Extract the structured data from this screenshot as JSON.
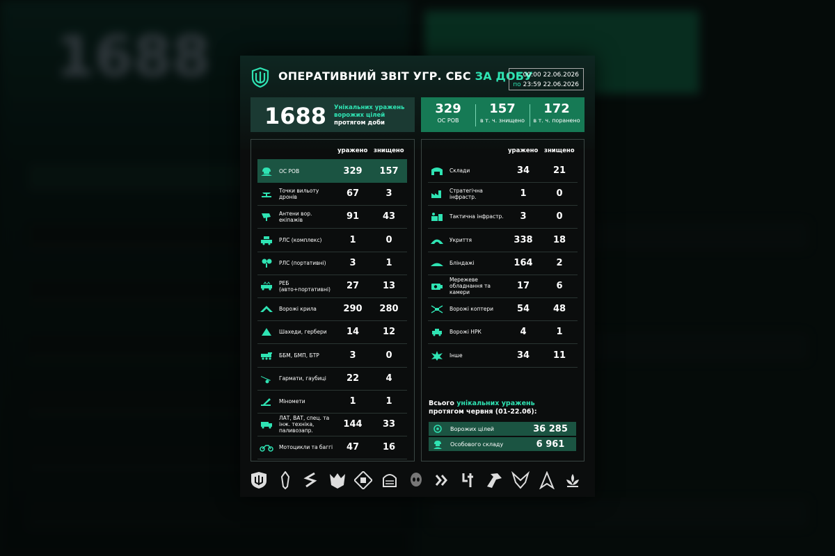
{
  "title": {
    "main": "ОПЕРАТИВНИЙ ЗВІТ УГР. СБС",
    "accent": "ЗА ДОБУ"
  },
  "period": {
    "from_prefix": "з",
    "from_time": "00:00",
    "from_date": "22.06.2026",
    "to_prefix": "по",
    "to_time": "23:59",
    "to_date": "22.06.2026"
  },
  "summary": {
    "unique_hits": "1688",
    "unique_hits_desc_1": "Унікальних уражень",
    "unique_hits_desc_2": "ворожих цілей",
    "unique_hits_desc_3": "протягом доби",
    "stats": [
      {
        "value": "329",
        "caption": "ОС РОВ"
      },
      {
        "value": "157",
        "caption": "в т. ч. знищено"
      },
      {
        "value": "172",
        "caption": "в т. ч. поранено"
      }
    ]
  },
  "table_headers": {
    "hit": "уражено",
    "destroyed": "знищено"
  },
  "left_rows": [
    {
      "icon": "soldier-icon",
      "label": "ОС РОВ",
      "hit": "329",
      "destroyed": "157",
      "highlight": true
    },
    {
      "icon": "drone-launch-icon",
      "label": "Точки вильоту дронів",
      "hit": "67",
      "destroyed": "3"
    },
    {
      "icon": "antenna-icon",
      "label": "Антени вор. екіпажів",
      "hit": "91",
      "destroyed": "43"
    },
    {
      "icon": "rls-complex-icon",
      "label": "РЛС (комплекс)",
      "hit": "1",
      "destroyed": "0"
    },
    {
      "icon": "rls-portable-icon",
      "label": "РЛС (портативні)",
      "hit": "3",
      "destroyed": "1"
    },
    {
      "icon": "ew-icon",
      "label": "РЕБ (авто+портативні)",
      "hit": "27",
      "destroyed": "13"
    },
    {
      "icon": "wing-icon",
      "label": "Ворожі крила",
      "hit": "290",
      "destroyed": "280"
    },
    {
      "icon": "shahed-icon",
      "label": "Шахеди, гербери",
      "hit": "14",
      "destroyed": "12"
    },
    {
      "icon": "ifv-icon",
      "label": "ББМ, БМП, БТР",
      "hit": "3",
      "destroyed": "0"
    },
    {
      "icon": "artillery-icon",
      "label": "Гармати, гаубиці",
      "hit": "22",
      "destroyed": "4"
    },
    {
      "icon": "mortar-icon",
      "label": "Міномети",
      "hit": "1",
      "destroyed": "1"
    },
    {
      "icon": "truck-icon",
      "label": "ЛАТ, ВАТ, спец. та інж. техніка, паливозапр.",
      "hit": "144",
      "destroyed": "33"
    },
    {
      "icon": "motorcycle-icon",
      "label": "Мотоцикли та баггі",
      "hit": "47",
      "destroyed": "16"
    }
  ],
  "right_rows": [
    {
      "icon": "warehouse-icon",
      "label": "Склади",
      "hit": "34",
      "destroyed": "21"
    },
    {
      "icon": "factory-icon",
      "label": "Стратегічна інфрастр.",
      "hit": "1",
      "destroyed": "0"
    },
    {
      "icon": "tactical-infra-icon",
      "label": "Тактична інфрастр.",
      "hit": "3",
      "destroyed": "0"
    },
    {
      "icon": "shelter-icon",
      "label": "Укриття",
      "hit": "338",
      "destroyed": "18"
    },
    {
      "icon": "dugout-icon",
      "label": "Бліндажі",
      "hit": "164",
      "destroyed": "2"
    },
    {
      "icon": "camera-icon",
      "label": "Мережеве обладнання та камери",
      "hit": "17",
      "destroyed": "6"
    },
    {
      "icon": "copter-icon",
      "label": "Ворожі коптери",
      "hit": "54",
      "destroyed": "48"
    },
    {
      "icon": "ugv-icon",
      "label": "Ворожі НРК",
      "hit": "4",
      "destroyed": "1"
    },
    {
      "icon": "explosion-icon",
      "label": "Інше",
      "hit": "34",
      "destroyed": "11"
    }
  ],
  "totals": {
    "title_1": "Всього",
    "title_accent": "унікальних уражень",
    "title_2": "протягом червня (01-22.06):",
    "rows": [
      {
        "icon": "target-icon",
        "label": "Ворожих цілей",
        "value": "36 285"
      },
      {
        "icon": "soldier-icon",
        "label": "Особового складу",
        "value": "6 961"
      }
    ]
  },
  "colors": {
    "accent": "#2fe3b3",
    "green_panel": "#167a55",
    "highlight_row": "#1b5442"
  },
  "unit_logos": [
    "trident-shield-logo",
    "sword-logo",
    "s-logo",
    "wolf-logo",
    "cube-logo",
    "helmet-logo",
    "alien-logo",
    "chevrons-logo",
    "lightning-logo",
    "bird-logo",
    "eagle-logo",
    "arrowhead-logo",
    "lotus-logo"
  ]
}
